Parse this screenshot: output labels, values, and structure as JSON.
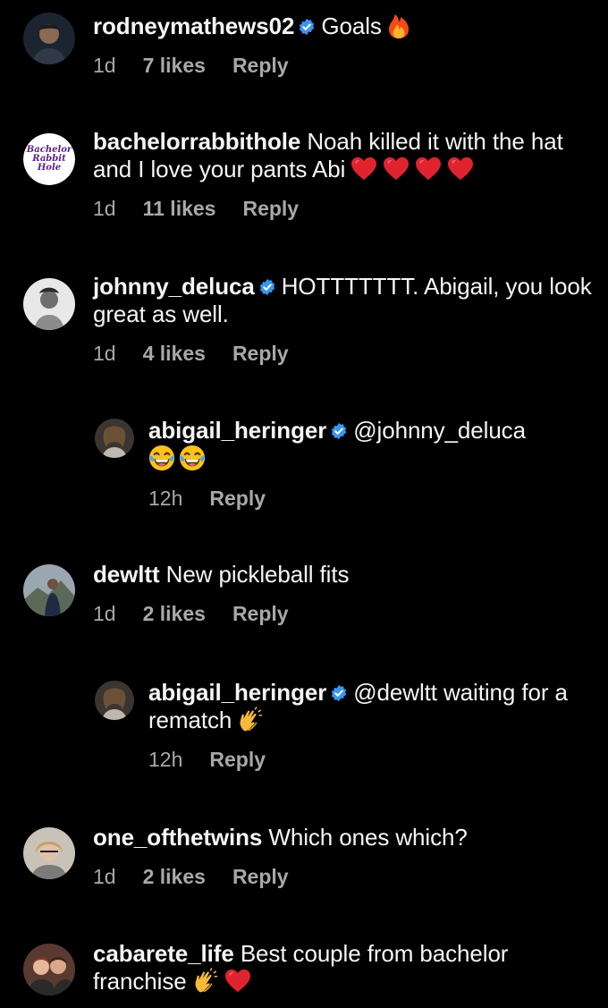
{
  "comments": [
    {
      "username": "rodneymathews02",
      "text": "Goals",
      "time": "1d",
      "likes": "7 likes",
      "reply": "Reply"
    },
    {
      "username": "bachelorrabbithole",
      "text": "Noah killed it with the hat and I love your pants Abi",
      "time": "1d",
      "likes": "11 likes",
      "reply": "Reply",
      "avatar_text": [
        "Bachelor",
        "Rabbit",
        "Hole"
      ]
    },
    {
      "username": "johnny_deluca",
      "text": "HOTTTTTTT. Abigail, you look great as well.",
      "time": "1d",
      "likes": "4 likes",
      "reply": "Reply"
    },
    {
      "username": "abigail_heringer",
      "text": "@johnny_deluca",
      "time": "12h",
      "reply": "Reply"
    },
    {
      "username": "dewltt",
      "text": "New pickleball fits",
      "time": "1d",
      "likes": "2 likes",
      "reply": "Reply"
    },
    {
      "username": "abigail_heringer",
      "text": "@dewltt waiting for a rematch",
      "time": "12h",
      "reply": "Reply"
    },
    {
      "username": "one_ofthetwins",
      "text": "Which ones which?",
      "time": "1d",
      "likes": "2 likes",
      "reply": "Reply"
    },
    {
      "username": "cabarete_life",
      "text": "Best couple from bachelor franchise",
      "time": "",
      "reply": ""
    }
  ],
  "colors": {
    "background": "#000000",
    "text": "#f5f5f5",
    "meta": "#a8a8a8",
    "verified": "#3897f0",
    "heart": "#e0242f"
  },
  "icons": [
    "verified-badge-icon",
    "fire-icon",
    "heart-icon",
    "laughing-emoji-icon",
    "clapping-hands-icon"
  ]
}
